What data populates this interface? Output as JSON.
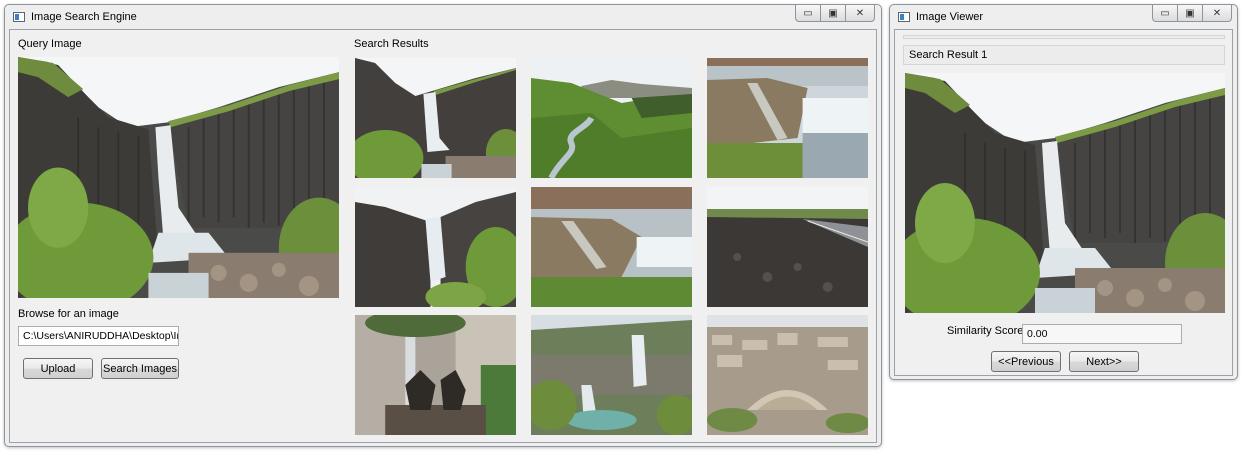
{
  "main_window": {
    "title": "Image Search Engine",
    "min_glyph": "▭",
    "max_glyph": "▣",
    "close_glyph": "✕",
    "query_label": "Query Image",
    "results_label": "Search Results",
    "browse_label": "Browse for an image",
    "path_value": "C:\\Users\\ANIRUDDHA\\Desktop\\Ima",
    "upload_label": "Upload",
    "search_label": "Search Images"
  },
  "viewer_window": {
    "title": "Image Viewer",
    "min_glyph": "▭",
    "max_glyph": "▣",
    "close_glyph": "✕",
    "result_title": "Search Result 1",
    "similarity_label": "Similarity Score:",
    "similarity_value": "0.00",
    "prev_label": "<<Previous",
    "next_label": "Next>>"
  },
  "results": [
    {
      "scene": "waterfall-canyon"
    },
    {
      "scene": "green-valley-river"
    },
    {
      "scene": "waterfall-steps"
    },
    {
      "scene": "waterfall-closeup"
    },
    {
      "scene": "waterfall-steps-wide"
    },
    {
      "scene": "lava-field-road"
    },
    {
      "scene": "city-fountain-statue"
    },
    {
      "scene": "waterfalls-lakes"
    },
    {
      "scene": "city-amphitheater"
    }
  ]
}
